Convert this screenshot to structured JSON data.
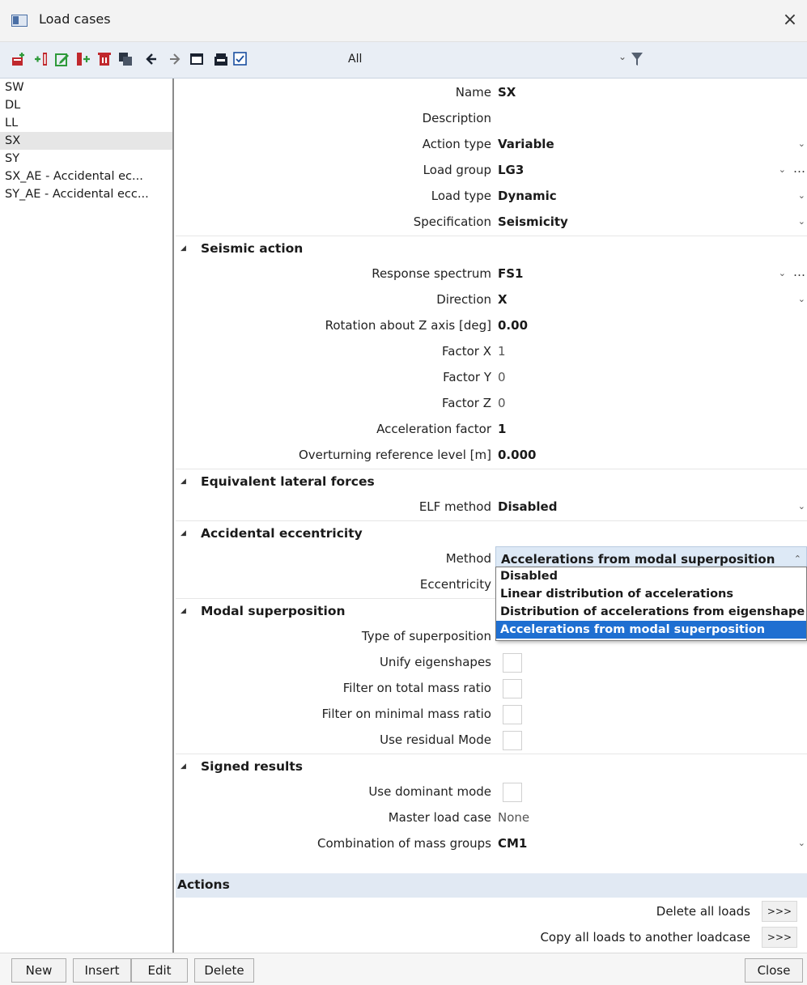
{
  "window": {
    "title": "Load cases",
    "close_symbol": "×"
  },
  "toolbar": {
    "filter_value": "All"
  },
  "load_cases": [
    "SW",
    "DL",
    "LL",
    "SX",
    "SY",
    "SX_AE - Accidental ec...",
    "SY_AE - Accidental ecc..."
  ],
  "selected_index": 3,
  "props": {
    "name_label": "Name",
    "name_value": "SX",
    "description_label": "Description",
    "description_value": "",
    "action_type_label": "Action type",
    "action_type_value": "Variable",
    "load_group_label": "Load group",
    "load_group_value": "LG3",
    "load_type_label": "Load type",
    "load_type_value": "Dynamic",
    "specification_label": "Specification",
    "specification_value": "Seismicity"
  },
  "seismic": {
    "title": "Seismic action",
    "response_spectrum_label": "Response spectrum",
    "response_spectrum_value": "FS1",
    "direction_label": "Direction",
    "direction_value": "X",
    "rotation_label": "Rotation about Z axis [deg]",
    "rotation_value": "0.00",
    "factor_x_label": "Factor X",
    "factor_x_value": "1",
    "factor_y_label": "Factor Y",
    "factor_y_value": "0",
    "factor_z_label": "Factor Z",
    "factor_z_value": "0",
    "acceleration_factor_label": "Acceleration factor",
    "acceleration_factor_value": "1",
    "overturning_label": "Overturning reference level [m]",
    "overturning_value": "0.000"
  },
  "elf": {
    "title": "Equivalent lateral forces",
    "method_label": "ELF method",
    "method_value": "Disabled"
  },
  "accidental": {
    "title": "Accidental eccentricity",
    "method_label": "Method",
    "method_value": "Accelerations from modal superposition",
    "eccentricity_label": "Eccentricity",
    "options": [
      "Disabled",
      "Linear distribution of accelerations",
      "Distribution of accelerations from eigenshape",
      "Accelerations from modal superposition"
    ]
  },
  "modal": {
    "title": "Modal superposition",
    "type_label": "Type of superposition",
    "unify_label": "Unify eigenshapes",
    "filter_total_label": "Filter on total mass ratio",
    "filter_minimal_label": "Filter on minimal mass ratio",
    "residual_label": "Use residual Mode"
  },
  "signed": {
    "title": "Signed results",
    "dominant_label": "Use dominant mode",
    "master_label": "Master load case",
    "master_value": "None",
    "combination_label": "Combination of mass groups",
    "combination_value": "CM1"
  },
  "actions": {
    "title": "Actions",
    "delete_label": "Delete all loads",
    "copy_label": "Copy all loads to another loadcase",
    "button_text": ">>>"
  },
  "buttons": {
    "new": "New",
    "insert": "Insert",
    "edit": "Edit",
    "delete": "Delete",
    "close": "Close"
  },
  "colors": {
    "selection_blue": "#1f6fd1",
    "toolbar_bg": "#e9eef5",
    "actions_bg": "#e1e9f3"
  }
}
